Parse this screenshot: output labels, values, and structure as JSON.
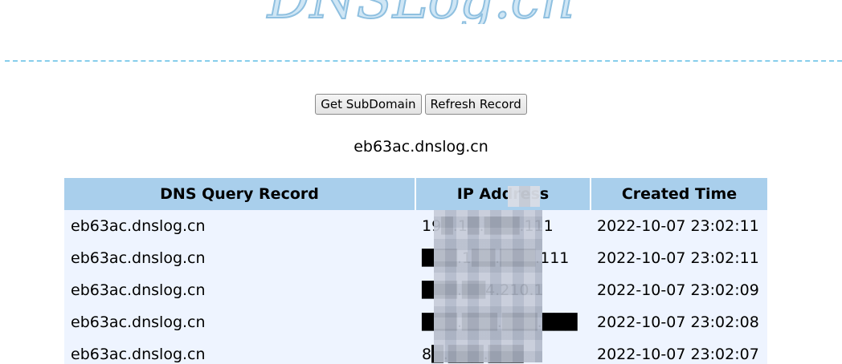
{
  "logo": {
    "text": "DNSLog.cn"
  },
  "toolbar": {
    "get_subdomain_label": "Get SubDomain",
    "refresh_record_label": "Refresh Record"
  },
  "subdomain": "eb63ac.dnslog.cn",
  "table": {
    "headers": [
      "DNS Query Record",
      "IP Address",
      "Created Time"
    ],
    "rows": [
      {
        "record": "eb63ac.dnslog.cn",
        "ip": "19█.1█.███.111",
        "time": "2022-10-07 23:02:11"
      },
      {
        "record": "eb63ac.dnslog.cn",
        "ip": "███.1██.███.111",
        "time": "2022-10-07 23:02:11"
      },
      {
        "record": "eb63ac.dnslog.cn",
        "ip": "███.██4.210.1",
        "time": "2022-10-07 23:02:09"
      },
      {
        "record": "eb63ac.dnslog.cn",
        "ip": "███.███.███.███",
        "time": "2022-10-07 23:02:08"
      },
      {
        "record": "eb63ac.dnslog.cn",
        "ip": "8█.███.███",
        "time": "2022-10-07 23:02:07"
      }
    ]
  },
  "colors": {
    "header_bg": "#a9cfec",
    "row_bg": "#eef4ff",
    "divider": "#87ceeb",
    "logo": "#8fc0e0"
  }
}
